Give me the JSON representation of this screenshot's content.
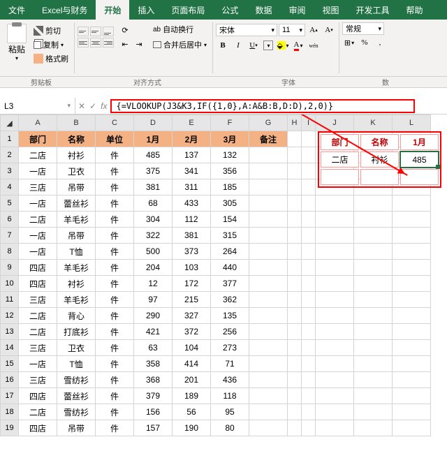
{
  "tabs": [
    "文件",
    "Excel与财务",
    "开始",
    "插入",
    "页面布局",
    "公式",
    "数据",
    "审阅",
    "视图",
    "开发工具",
    "帮助"
  ],
  "active_tab": "开始",
  "ribbon": {
    "paste": "粘贴",
    "cut": "剪切",
    "copy": "复制",
    "format_painter": "格式刷",
    "wrap_text": "自动换行",
    "merge_center": "合并后居中",
    "font_name": "宋体",
    "font_size": "11",
    "number_format": "常规",
    "sections": {
      "clipboard": "剪贴板",
      "alignment": "对齐方式",
      "font": "字体",
      "number": "数"
    }
  },
  "cell_ref": "L3",
  "formula": "{=VLOOKUP(J3&K3,IF({1,0},A:A&B:B,D:D),2,0)}",
  "columns": [
    "A",
    "B",
    "C",
    "D",
    "E",
    "F",
    "G",
    "H",
    "I",
    "J",
    "K",
    "L"
  ],
  "headers": [
    "部门",
    "名称",
    "单位",
    "1月",
    "2月",
    "3月",
    "备注"
  ],
  "rows": [
    [
      "二店",
      "衬衫",
      "件",
      "485",
      "137",
      "132",
      ""
    ],
    [
      "一店",
      "卫衣",
      "件",
      "375",
      "341",
      "356",
      ""
    ],
    [
      "三店",
      "吊带",
      "件",
      "381",
      "311",
      "185",
      ""
    ],
    [
      "一店",
      "蕾丝衫",
      "件",
      "68",
      "433",
      "305",
      ""
    ],
    [
      "二店",
      "羊毛衫",
      "件",
      "304",
      "112",
      "154",
      ""
    ],
    [
      "一店",
      "吊带",
      "件",
      "322",
      "381",
      "315",
      ""
    ],
    [
      "一店",
      "T恤",
      "件",
      "500",
      "373",
      "264",
      ""
    ],
    [
      "四店",
      "羊毛衫",
      "件",
      "204",
      "103",
      "440",
      ""
    ],
    [
      "四店",
      "衬衫",
      "件",
      "12",
      "172",
      "377",
      ""
    ],
    [
      "三店",
      "羊毛衫",
      "件",
      "97",
      "215",
      "362",
      ""
    ],
    [
      "二店",
      "背心",
      "件",
      "290",
      "327",
      "135",
      ""
    ],
    [
      "二店",
      "打底衫",
      "件",
      "421",
      "372",
      "256",
      ""
    ],
    [
      "三店",
      "卫衣",
      "件",
      "63",
      "104",
      "273",
      ""
    ],
    [
      "一店",
      "T恤",
      "件",
      "358",
      "414",
      "71",
      ""
    ],
    [
      "三店",
      "雪纺衫",
      "件",
      "368",
      "201",
      "436",
      ""
    ],
    [
      "四店",
      "蕾丝衫",
      "件",
      "379",
      "189",
      "118",
      ""
    ],
    [
      "二店",
      "雪纺衫",
      "件",
      "156",
      "56",
      "95",
      ""
    ],
    [
      "四店",
      "吊带",
      "件",
      "157",
      "190",
      "80",
      ""
    ]
  ],
  "lookup": {
    "headers": [
      "部门",
      "名称",
      "1月"
    ],
    "row": [
      "二店",
      "衬衫",
      "485"
    ]
  }
}
